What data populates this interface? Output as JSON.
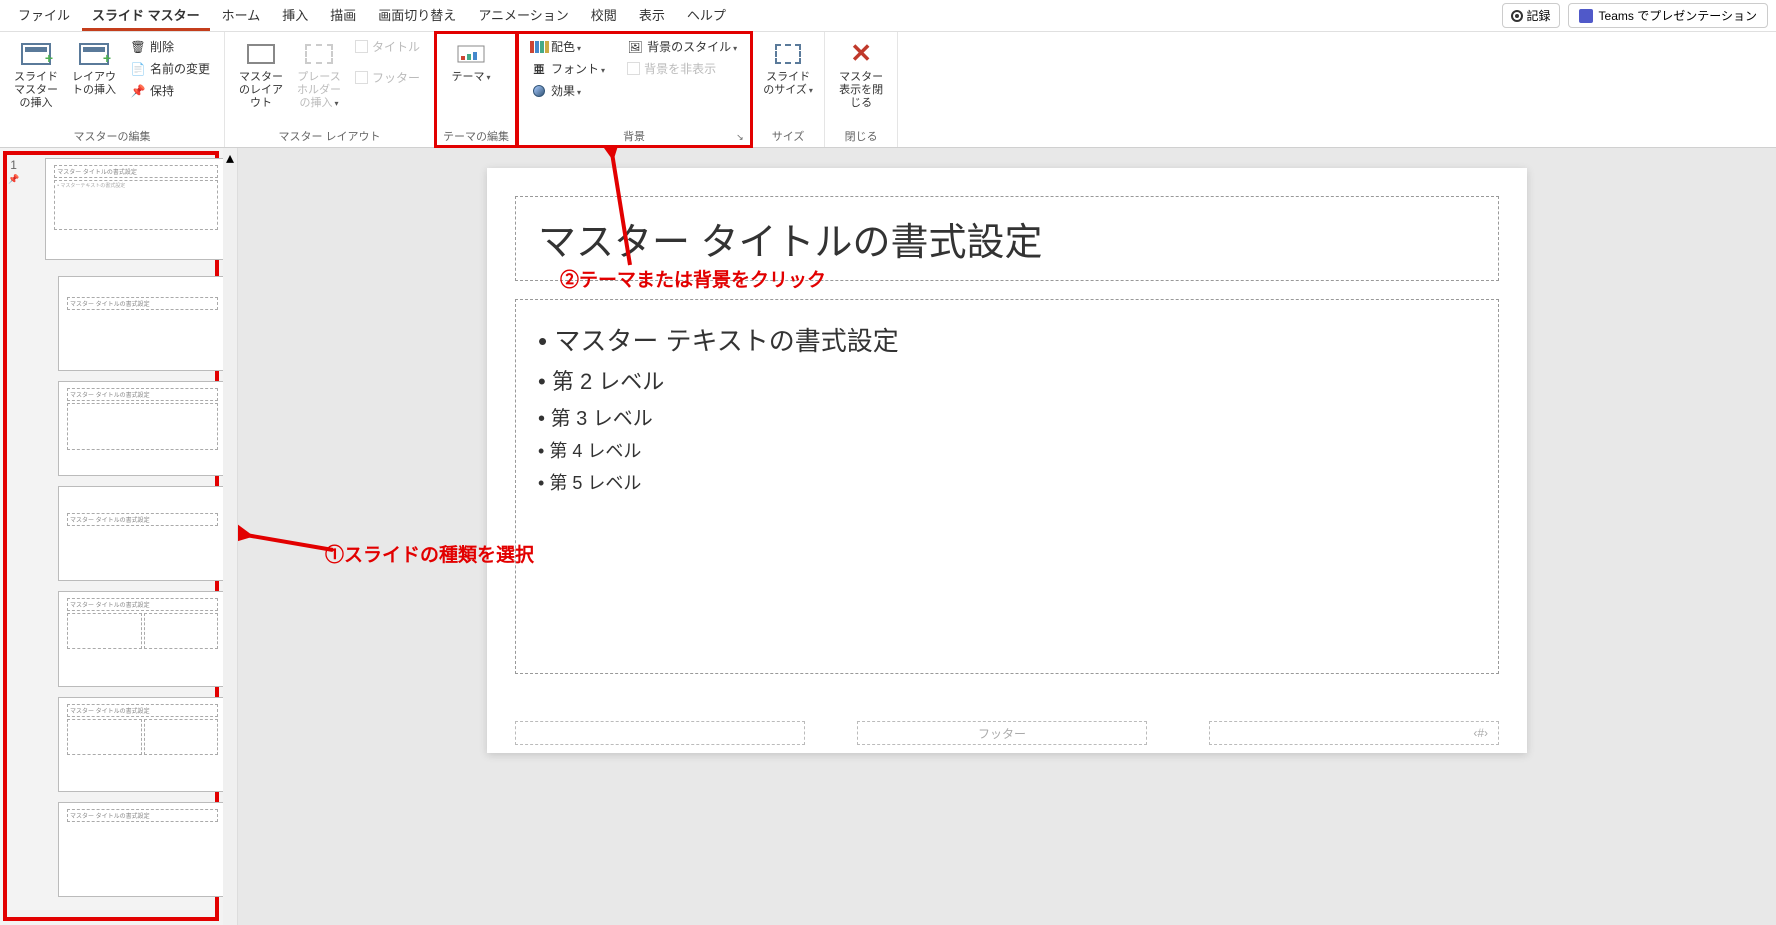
{
  "menu": {
    "items": [
      "ファイル",
      "スライド マスター",
      "ホーム",
      "挿入",
      "描画",
      "画面切り替え",
      "アニメーション",
      "校閲",
      "表示",
      "ヘルプ"
    ],
    "active_index": 1,
    "record": "記録",
    "teams": "Teams でプレゼンテーション"
  },
  "ribbon": {
    "g_edit_master": {
      "label": "マスターの編集",
      "insert_slide_master": "スライド マスターの挿入",
      "insert_layout": "レイアウトの挿入",
      "delete": "削除",
      "rename": "名前の変更",
      "preserve": "保持"
    },
    "g_master_layout": {
      "label": "マスター レイアウト",
      "master_layout": "マスターのレイアウト",
      "insert_placeholder": "プレースホルダーの挿入",
      "title_chk": "タイトル",
      "footer_chk": "フッター"
    },
    "g_edit_theme": {
      "label": "テーマの編集",
      "theme": "テーマ"
    },
    "g_background": {
      "label": "背景",
      "colors": "配色",
      "fonts": "フォント",
      "effects": "効果",
      "bg_styles": "背景のスタイル",
      "hide_bg": "背景を非表示"
    },
    "g_size": {
      "label": "サイズ",
      "slide_size": "スライドのサイズ"
    },
    "g_close": {
      "label": "閉じる",
      "close_master": "マスター表示を閉じる"
    }
  },
  "thumbs": {
    "slide_number": "1",
    "mini_title": "マスター タイトルの書式設定",
    "mini_body": "• マスターテキストの書式設定"
  },
  "slide": {
    "title": "マスター タイトルの書式設定",
    "body_l1": "マスター テキストの書式設定",
    "body_l2": "第 2 レベル",
    "body_l3": "第 3 レベル",
    "body_l4": "第 4 レベル",
    "body_l5": "第 5 レベル",
    "footer": "フッター",
    "number": "‹#›"
  },
  "annotations": {
    "step1": "①スライドの種類を選択",
    "step2": "②テーマまたは背景をクリック"
  }
}
